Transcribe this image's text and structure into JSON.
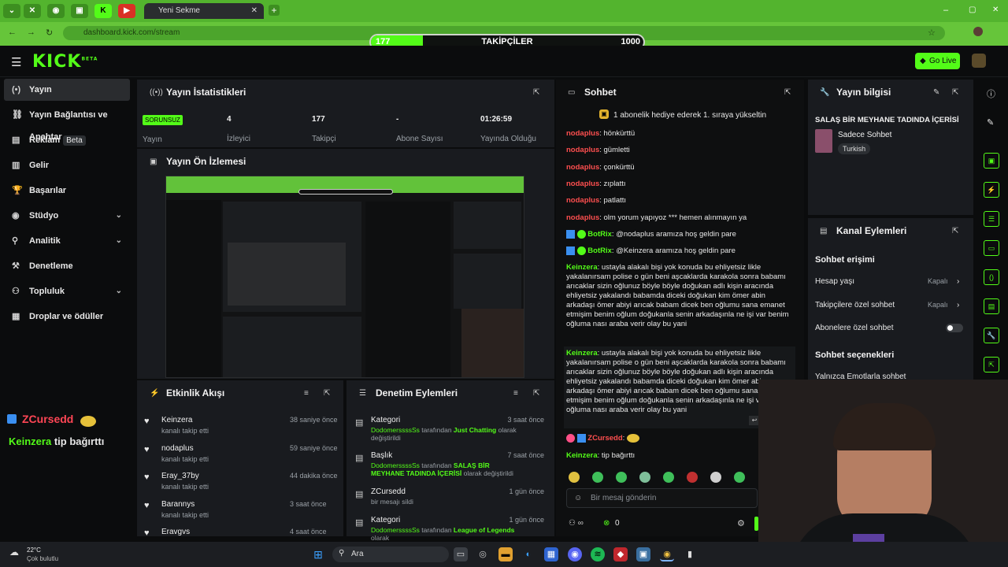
{
  "browser": {
    "tab_title": "Yeni Sekme",
    "url": "dashboard.kick.com/stream",
    "tab_icons": [
      "chevron-down-icon",
      "x-icon",
      "gamepad-icon",
      "tv-icon",
      "kick-icon",
      "youtube-icon"
    ],
    "new_tab": "+",
    "window_controls": [
      "–",
      "▢",
      "✕"
    ]
  },
  "follower_goal": {
    "label": "TAKİPÇİLER",
    "current": "177",
    "target": "1000",
    "fraction": 0.177
  },
  "header": {
    "logo": "KICK",
    "logo_badge": "BETA",
    "go_live": "Go Live"
  },
  "sidebar": {
    "items": [
      {
        "label": "Yayın",
        "icon": "(•)",
        "active": true
      },
      {
        "label": "Yayın Bağlantısı ve Anahtar",
        "icon": "⛓"
      },
      {
        "label": "Reklam",
        "icon": "▤",
        "badge": "Beta"
      },
      {
        "label": "Gelir",
        "icon": "▥"
      },
      {
        "label": "Başarılar",
        "icon": "🏆"
      },
      {
        "label": "Stüdyo",
        "icon": "◉",
        "chevron": "⌄"
      },
      {
        "label": "Analitik",
        "icon": "⚲",
        "chevron": "⌄"
      },
      {
        "label": "Denetleme",
        "icon": "⚒"
      },
      {
        "label": "Topluluk",
        "icon": "⚇",
        "chevron": "⌄"
      },
      {
        "label": "Droplar ve ödüller",
        "icon": "▦"
      }
    ]
  },
  "overlay": {
    "line1": "ZCursedd",
    "line2_user": "Keinzera",
    "line2_text": "tip bağırttı"
  },
  "stats": {
    "title": "Yayın İstatistikleri",
    "status_badge": "SORUNSUZ",
    "status_label": "Yayın",
    "items": [
      {
        "value": "4",
        "label": "İzleyici"
      },
      {
        "value": "177",
        "label": "Takipçi"
      },
      {
        "value": "-",
        "label": "Abone Sayısı"
      },
      {
        "value": "01:26:59",
        "label": "Yayında Olduğu Süre"
      }
    ]
  },
  "preview": {
    "title": "Yayın Ön İzlemesi"
  },
  "activity": {
    "title": "Etkinlik Akışı",
    "items": [
      {
        "name": "Keinzera",
        "sub": "kanalı takip etti",
        "time": "38 saniye önce"
      },
      {
        "name": "nodaplus",
        "sub": "kanalı takip etti",
        "time": "59 saniye önce"
      },
      {
        "name": "Eray_37by",
        "sub": "kanalı takip etti",
        "time": "44 dakika önce"
      },
      {
        "name": "Barannys",
        "sub": "kanalı takip etti",
        "time": "3 saat önce"
      },
      {
        "name": "Eravgvs",
        "sub": "",
        "time": "4 saat önce"
      }
    ]
  },
  "moderation": {
    "title": "Denetim Eylemleri",
    "items": [
      {
        "name": "Kategori",
        "time": "3 saat önce",
        "actor": "DodomerssssSs",
        "mid": "tarafından",
        "value": "Just Chatting",
        "tail": "olarak değiştirildi"
      },
      {
        "name": "Başlık",
        "time": "7 saat önce",
        "actor": "DodomerssssSs",
        "mid": "tarafından",
        "value": "SALAŞ BİR MEYHANE TADINDA İÇERİSİ",
        "tail": "olarak değiştirildi"
      },
      {
        "name": "ZCursedd",
        "time": "1 gün önce",
        "actor": "",
        "mid": "bir mesajı sildi",
        "value": "",
        "tail": ""
      },
      {
        "name": "Kategori",
        "time": "1 gün önce",
        "actor": "DodomerssssSs",
        "mid": "tarafından",
        "value": "League of Legends",
        "tail": "olarak"
      }
    ]
  },
  "chat": {
    "title": "Sohbet",
    "pinned": "1 abonelik hediye ederek 1. sıraya yükseltin",
    "messages": [
      {
        "user": "nodaplus",
        "text": "hönkürttü"
      },
      {
        "user": "nodaplus",
        "text": "gümletti"
      },
      {
        "user": "nodaplus",
        "text": "çonkürttü"
      },
      {
        "user": "nodaplus",
        "text": "zıplattı"
      },
      {
        "user": "nodaplus",
        "text": "patlattı"
      },
      {
        "user": "nodaplus",
        "text": "olm yorum yapıyoz *** hemen alınmayın ya"
      },
      {
        "user": "BotRix",
        "text": "@nodaplus aramıza hoş geldin pare"
      },
      {
        "user": "BotRix",
        "text": "@Keinzera aramıza hoş geldin pare"
      }
    ],
    "long_user": "Keinzera",
    "long_text": "ustayla alakalı bişi yok konuda bu ehliyetsiz likle yakalanırsam polise o gün beni aşcaklarda karakola sonra babamı arıcaklar sizin oğlunuz böyle böyle doğukan adlı kişin aracında ehliyetsiz yakalandı babamda diceki doğukan kim ömer abin arkadaşı ömer abiyi arıcak babam dicek ben oğlumu sana emanet etmişim benim oğlum doğukanla senin arkadaşınla ne işi var benim oğluma nası araba verir olay bu yani",
    "zc_user": "ZCursedd",
    "tip_user": "Keinzera",
    "tip_text": "tip bağırttı",
    "input_placeholder": "Bir mesaj gönderin",
    "points": "0"
  },
  "stream_info": {
    "title": "Yayın bilgisi",
    "stream_title": "SALAŞ BİR MEYHANE TADINDA İÇERİSİ",
    "category": "Sadece Sohbet",
    "language": "Turkish"
  },
  "channel_actions": {
    "title": "Kanal Eylemleri",
    "section1": "Sohbet erişimi",
    "rows": [
      {
        "label": "Hesap yaşı",
        "value": "Kapalı"
      },
      {
        "label": "Takipçilere özel sohbet",
        "value": "Kapalı"
      },
      {
        "label": "Abonelere özel sohbet",
        "value": ""
      }
    ],
    "section2": "Sohbet seçenekleri",
    "row_cut": "Yalnızca Emotlarla sohbet"
  },
  "taskbar": {
    "weather_temp": "22°C",
    "weather_desc": "Çok bulutlu",
    "search": "Ara"
  },
  "colors": {
    "kick_green": "#53fc18",
    "panel": "#191b1f",
    "bg": "#0b0c0d",
    "username_red": "#ff4f4f"
  }
}
